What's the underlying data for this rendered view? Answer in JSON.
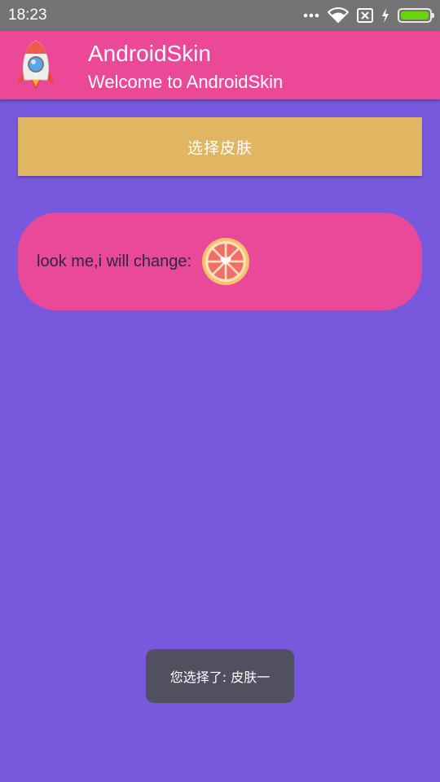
{
  "status_bar": {
    "time": "18:23",
    "icons": [
      "more-dots-icon",
      "wifi-icon",
      "no-sim-icon",
      "charging-bolt-icon",
      "battery-icon"
    ],
    "battery_color": "#6bd40a"
  },
  "toolbar": {
    "title": "AndroidSkin",
    "subtitle": "Welcome to AndroidSkin",
    "logo_icon": "rocket-icon",
    "background": "#ec4898"
  },
  "main": {
    "skin_button_label": "选择皮肤",
    "skin_button_color": "#e0b663",
    "card_text": "look me,i will change:",
    "card_icon": "grapefruit-icon",
    "card_color": "#ea4898",
    "background": "#7859dd"
  },
  "toast": {
    "text": "您选择了: 皮肤一"
  }
}
